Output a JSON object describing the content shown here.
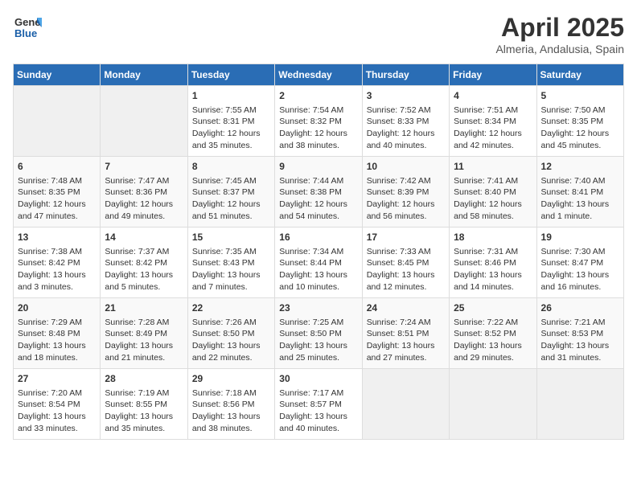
{
  "header": {
    "logo_general": "General",
    "logo_blue": "Blue",
    "title": "April 2025",
    "subtitle": "Almeria, Andalusia, Spain"
  },
  "calendar": {
    "days_of_week": [
      "Sunday",
      "Monday",
      "Tuesday",
      "Wednesday",
      "Thursday",
      "Friday",
      "Saturday"
    ],
    "weeks": [
      [
        {
          "num": "",
          "lines": []
        },
        {
          "num": "",
          "lines": []
        },
        {
          "num": "1",
          "lines": [
            "Sunrise: 7:55 AM",
            "Sunset: 8:31 PM",
            "Daylight: 12 hours",
            "and 35 minutes."
          ]
        },
        {
          "num": "2",
          "lines": [
            "Sunrise: 7:54 AM",
            "Sunset: 8:32 PM",
            "Daylight: 12 hours",
            "and 38 minutes."
          ]
        },
        {
          "num": "3",
          "lines": [
            "Sunrise: 7:52 AM",
            "Sunset: 8:33 PM",
            "Daylight: 12 hours",
            "and 40 minutes."
          ]
        },
        {
          "num": "4",
          "lines": [
            "Sunrise: 7:51 AM",
            "Sunset: 8:34 PM",
            "Daylight: 12 hours",
            "and 42 minutes."
          ]
        },
        {
          "num": "5",
          "lines": [
            "Sunrise: 7:50 AM",
            "Sunset: 8:35 PM",
            "Daylight: 12 hours",
            "and 45 minutes."
          ]
        }
      ],
      [
        {
          "num": "6",
          "lines": [
            "Sunrise: 7:48 AM",
            "Sunset: 8:35 PM",
            "Daylight: 12 hours",
            "and 47 minutes."
          ]
        },
        {
          "num": "7",
          "lines": [
            "Sunrise: 7:47 AM",
            "Sunset: 8:36 PM",
            "Daylight: 12 hours",
            "and 49 minutes."
          ]
        },
        {
          "num": "8",
          "lines": [
            "Sunrise: 7:45 AM",
            "Sunset: 8:37 PM",
            "Daylight: 12 hours",
            "and 51 minutes."
          ]
        },
        {
          "num": "9",
          "lines": [
            "Sunrise: 7:44 AM",
            "Sunset: 8:38 PM",
            "Daylight: 12 hours",
            "and 54 minutes."
          ]
        },
        {
          "num": "10",
          "lines": [
            "Sunrise: 7:42 AM",
            "Sunset: 8:39 PM",
            "Daylight: 12 hours",
            "and 56 minutes."
          ]
        },
        {
          "num": "11",
          "lines": [
            "Sunrise: 7:41 AM",
            "Sunset: 8:40 PM",
            "Daylight: 12 hours",
            "and 58 minutes."
          ]
        },
        {
          "num": "12",
          "lines": [
            "Sunrise: 7:40 AM",
            "Sunset: 8:41 PM",
            "Daylight: 13 hours",
            "and 1 minute."
          ]
        }
      ],
      [
        {
          "num": "13",
          "lines": [
            "Sunrise: 7:38 AM",
            "Sunset: 8:42 PM",
            "Daylight: 13 hours",
            "and 3 minutes."
          ]
        },
        {
          "num": "14",
          "lines": [
            "Sunrise: 7:37 AM",
            "Sunset: 8:42 PM",
            "Daylight: 13 hours",
            "and 5 minutes."
          ]
        },
        {
          "num": "15",
          "lines": [
            "Sunrise: 7:35 AM",
            "Sunset: 8:43 PM",
            "Daylight: 13 hours",
            "and 7 minutes."
          ]
        },
        {
          "num": "16",
          "lines": [
            "Sunrise: 7:34 AM",
            "Sunset: 8:44 PM",
            "Daylight: 13 hours",
            "and 10 minutes."
          ]
        },
        {
          "num": "17",
          "lines": [
            "Sunrise: 7:33 AM",
            "Sunset: 8:45 PM",
            "Daylight: 13 hours",
            "and 12 minutes."
          ]
        },
        {
          "num": "18",
          "lines": [
            "Sunrise: 7:31 AM",
            "Sunset: 8:46 PM",
            "Daylight: 13 hours",
            "and 14 minutes."
          ]
        },
        {
          "num": "19",
          "lines": [
            "Sunrise: 7:30 AM",
            "Sunset: 8:47 PM",
            "Daylight: 13 hours",
            "and 16 minutes."
          ]
        }
      ],
      [
        {
          "num": "20",
          "lines": [
            "Sunrise: 7:29 AM",
            "Sunset: 8:48 PM",
            "Daylight: 13 hours",
            "and 18 minutes."
          ]
        },
        {
          "num": "21",
          "lines": [
            "Sunrise: 7:28 AM",
            "Sunset: 8:49 PM",
            "Daylight: 13 hours",
            "and 21 minutes."
          ]
        },
        {
          "num": "22",
          "lines": [
            "Sunrise: 7:26 AM",
            "Sunset: 8:50 PM",
            "Daylight: 13 hours",
            "and 22 minutes."
          ]
        },
        {
          "num": "23",
          "lines": [
            "Sunrise: 7:25 AM",
            "Sunset: 8:50 PM",
            "Daylight: 13 hours",
            "and 25 minutes."
          ]
        },
        {
          "num": "24",
          "lines": [
            "Sunrise: 7:24 AM",
            "Sunset: 8:51 PM",
            "Daylight: 13 hours",
            "and 27 minutes."
          ]
        },
        {
          "num": "25",
          "lines": [
            "Sunrise: 7:22 AM",
            "Sunset: 8:52 PM",
            "Daylight: 13 hours",
            "and 29 minutes."
          ]
        },
        {
          "num": "26",
          "lines": [
            "Sunrise: 7:21 AM",
            "Sunset: 8:53 PM",
            "Daylight: 13 hours",
            "and 31 minutes."
          ]
        }
      ],
      [
        {
          "num": "27",
          "lines": [
            "Sunrise: 7:20 AM",
            "Sunset: 8:54 PM",
            "Daylight: 13 hours",
            "and 33 minutes."
          ]
        },
        {
          "num": "28",
          "lines": [
            "Sunrise: 7:19 AM",
            "Sunset: 8:55 PM",
            "Daylight: 13 hours",
            "and 35 minutes."
          ]
        },
        {
          "num": "29",
          "lines": [
            "Sunrise: 7:18 AM",
            "Sunset: 8:56 PM",
            "Daylight: 13 hours",
            "and 38 minutes."
          ]
        },
        {
          "num": "30",
          "lines": [
            "Sunrise: 7:17 AM",
            "Sunset: 8:57 PM",
            "Daylight: 13 hours",
            "and 40 minutes."
          ]
        },
        {
          "num": "",
          "lines": []
        },
        {
          "num": "",
          "lines": []
        },
        {
          "num": "",
          "lines": []
        }
      ]
    ]
  }
}
